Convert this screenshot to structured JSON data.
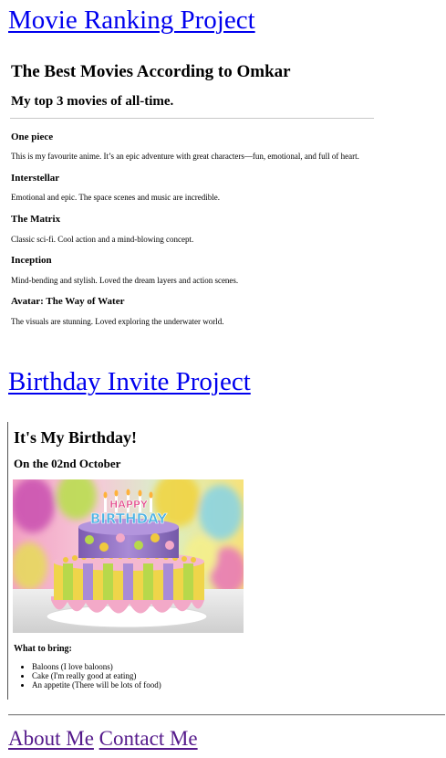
{
  "movie_project": {
    "title": "Movie Ranking Project",
    "heading": "The Best Movies According to Omkar",
    "subheading": "My top 3 movies of all-time.",
    "movies": [
      {
        "title": "One piece",
        "description": "This is my favourite anime. It’s an epic adventure with great characters—fun, emotional, and full of heart."
      },
      {
        "title": "Interstellar",
        "description": "Emotional and epic. The space scenes and music are incredible."
      },
      {
        "title": "The Matrix",
        "description": "Classic sci-fi. Cool action and a mind-blowing concept."
      },
      {
        "title": "Inception",
        "description": "Mind-bending and stylish. Loved the dream layers and action scenes."
      },
      {
        "title": "Avatar: The Way of Water",
        "description": "The visuals are stunning. Loved exploring the underwater world."
      }
    ]
  },
  "birthday_project": {
    "title": "Birthday Invite Project",
    "heading": "It's My Birthday!",
    "subheading": "On the 02nd October",
    "cake_image": {
      "topper_text_line1": "HAPPY",
      "topper_text_line2": "BIRTHDAY"
    },
    "bring_heading": "What to bring:",
    "bring_items": [
      "Baloons (I love baloons)",
      "Cake (I'm really good at eating)",
      "An appetite (There will be lots of food)"
    ]
  },
  "footer": {
    "about_label": "About Me",
    "contact_label": "Contact Me"
  },
  "colors": {
    "link_unvisited": "#0000EE",
    "link_visited": "#551A8B"
  }
}
